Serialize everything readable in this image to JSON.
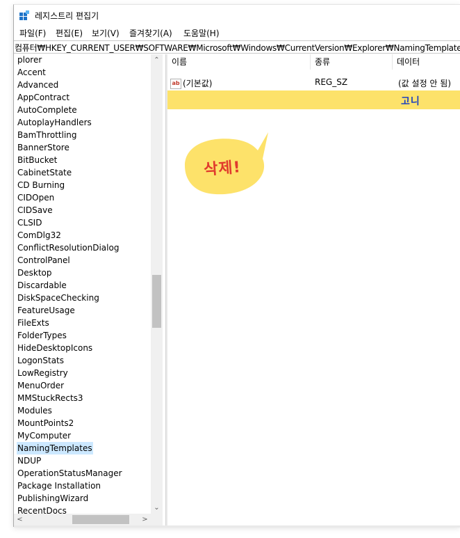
{
  "window": {
    "title": "레지스트리 편집기",
    "accent_color": "#1a3fc0"
  },
  "menu": [
    "파일(F)",
    "편집(E)",
    "보기(V)",
    "즐겨찾기(A)",
    "도움말(H)"
  ],
  "address": "컴퓨터₩HKEY_CURRENT_USER₩SOFTWARE₩Microsoft₩Windows₩CurrentVersion₩Explorer₩NamingTemplates",
  "tree": {
    "items": [
      "plorer",
      "Accent",
      "Advanced",
      "AppContract",
      "AutoComplete",
      "AutoplayHandlers",
      "BamThrottling",
      "BannerStore",
      "BitBucket",
      "CabinetState",
      "CD Burning",
      "CIDOpen",
      "CIDSave",
      "CLSID",
      "ComDlg32",
      "ConflictResolutionDialog",
      "ControlPanel",
      "Desktop",
      "Discardable",
      "DiskSpaceChecking",
      "FeatureUsage",
      "FileExts",
      "FolderTypes",
      "HideDesktopIcons",
      "LogonStats",
      "LowRegistry",
      "MenuOrder",
      "MMStuckRects3",
      "Modules",
      "MountPoints2",
      "MyComputer",
      "NamingTemplates",
      "NDUP",
      "OperationStatusManager",
      "Package Installation",
      "PublishingWizard",
      "RecentDocs"
    ],
    "selected": "NamingTemplates"
  },
  "list": {
    "columns": [
      "이름",
      "종류",
      "데이터"
    ],
    "rows": [
      {
        "icon": "string-value-icon",
        "icon_text": "ab",
        "name": "(기본값)",
        "type": "REG_SZ",
        "data": "(값 설정 안 됨)"
      }
    ]
  },
  "annotation": {
    "highlight_text": "고니",
    "highlight_color": "#fde26a",
    "bubble_text": "삭제!",
    "bubble_color": "#fde26a",
    "bubble_text_color": "#e03a2d"
  }
}
